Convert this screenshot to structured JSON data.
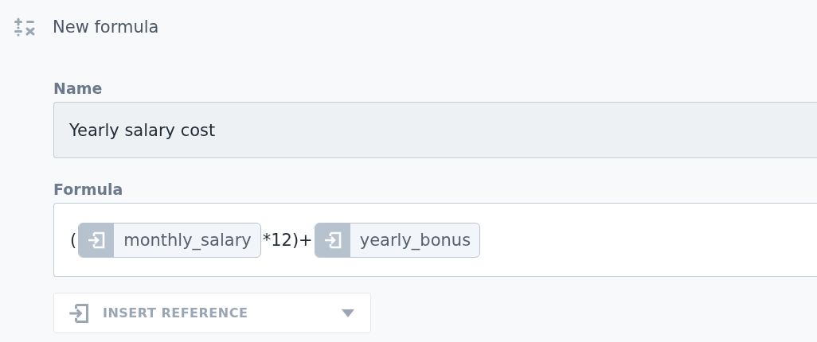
{
  "header": {
    "title": "New formula"
  },
  "name_field": {
    "label": "Name",
    "value": "Yearly salary cost"
  },
  "formula_field": {
    "label": "Formula",
    "tokens": [
      {
        "kind": "text",
        "text": "("
      },
      {
        "kind": "reference",
        "text": "monthly_salary"
      },
      {
        "kind": "text",
        "text": "*12)+"
      },
      {
        "kind": "reference",
        "text": "yearly_bonus"
      }
    ]
  },
  "insert_button": {
    "label": "INSERT REFERENCE"
  }
}
